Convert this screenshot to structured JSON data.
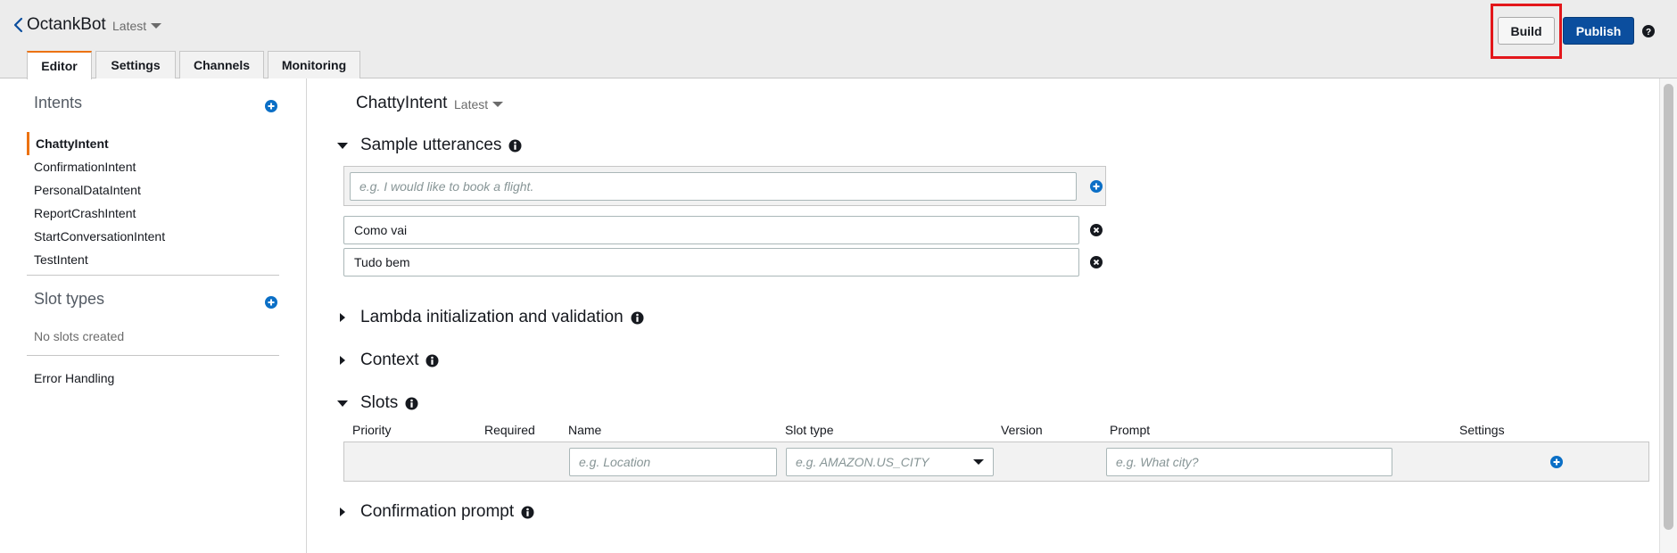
{
  "header": {
    "bot_name": "OctankBot",
    "bot_version": "Latest",
    "tabs": [
      {
        "label": "Editor",
        "active": true
      },
      {
        "label": "Settings",
        "active": false
      },
      {
        "label": "Channels",
        "active": false
      },
      {
        "label": "Monitoring",
        "active": false
      }
    ],
    "build_label": "Build",
    "publish_label": "Publish",
    "highlight_color": "#e3171b",
    "publish_color": "#0b4e9e",
    "accent_color": "#ec7211"
  },
  "sidebar": {
    "intents_title": "Intents",
    "intents": [
      {
        "label": "ChattyIntent",
        "active": true
      },
      {
        "label": "ConfirmationIntent",
        "active": false
      },
      {
        "label": "PersonalDataIntent",
        "active": false
      },
      {
        "label": "ReportCrashIntent",
        "active": false
      },
      {
        "label": "StartConversationIntent",
        "active": false
      },
      {
        "label": "TestIntent",
        "active": false
      }
    ],
    "slot_types_title": "Slot types",
    "no_slots_text": "No slots created",
    "error_handling_label": "Error Handling"
  },
  "main": {
    "intent_name": "ChattyIntent",
    "intent_version": "Latest",
    "sections": {
      "sample_utterances": "Sample utterances",
      "lambda": "Lambda initialization and validation",
      "context": "Context",
      "slots": "Slots",
      "confirmation_prompt": "Confirmation prompt"
    },
    "utterance_placeholder": "e.g. I would like to book a flight.",
    "utterances": [
      "Como vai",
      "Tudo bem"
    ],
    "slots_columns": {
      "priority": "Priority",
      "required": "Required",
      "name": "Name",
      "slot_type": "Slot type",
      "version": "Version",
      "prompt": "Prompt",
      "settings": "Settings"
    },
    "slot_name_placeholder": "e.g. Location",
    "slot_type_placeholder": "e.g. AMAZON.US_CITY",
    "slot_prompt_placeholder": "e.g. What city?"
  },
  "icons": {
    "back": "chevron-left-icon",
    "help": "question-circle-icon",
    "add": "plus-circle-icon",
    "remove": "x-circle-icon",
    "info": "info-circle-icon"
  }
}
